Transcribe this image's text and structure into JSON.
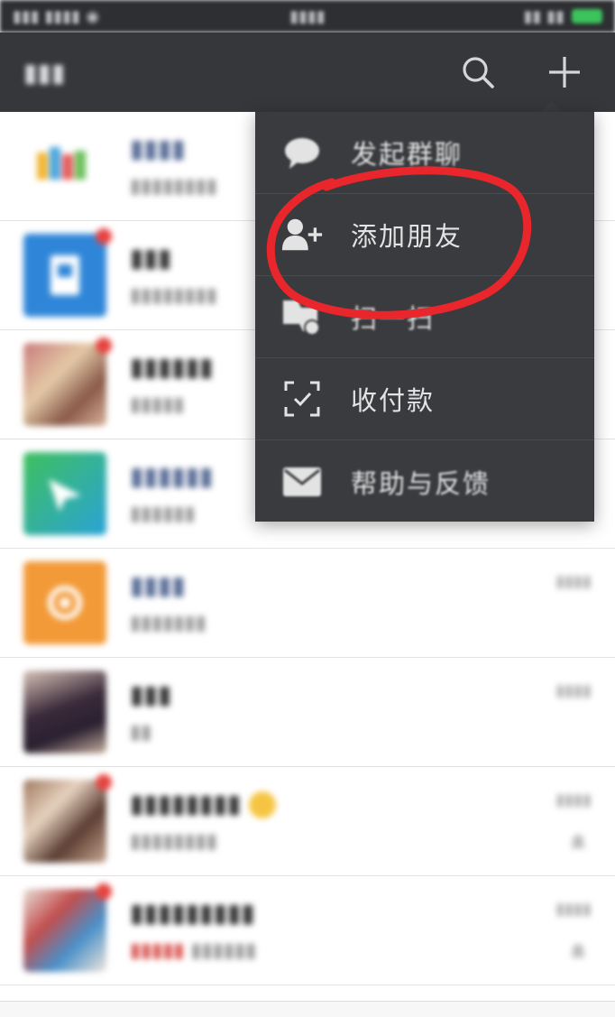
{
  "colors": {
    "nav_bg": "#36373b",
    "menu_bg": "#3a3b3f",
    "annotation": "#e8262b",
    "unread_badge": "#e64340"
  },
  "nav": {
    "search_icon": "search-icon",
    "add_icon": "plus-icon"
  },
  "menu": {
    "items": [
      {
        "label": "发起群聊",
        "icon": "chat-bubble-icon"
      },
      {
        "label": "添加朋友",
        "icon": "add-friend-icon"
      },
      {
        "label": "扫一扫",
        "icon": "scan-icon"
      },
      {
        "label": "收付款",
        "icon": "payment-icon"
      },
      {
        "label": "帮助与反馈",
        "icon": "mail-icon"
      }
    ]
  },
  "annotation": {
    "shape": "hand-drawn-circle",
    "target": "添加朋友"
  }
}
